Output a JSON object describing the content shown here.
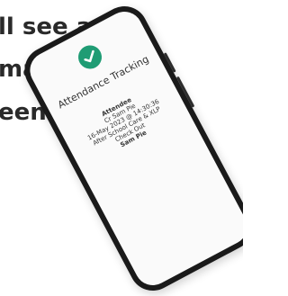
{
  "hero_text": {
    "line1": "ll see a",
    "line2": "mation",
    "line3": "een"
  },
  "screen": {
    "title": "Attendance Tracking",
    "check_color": "#1f9c74",
    "details": {
      "heading": "Attendee",
      "attendee_short": "Cr Sam Pie",
      "datetime": "16-May 2023 @ 14:30:36",
      "program": "After School Care & XLP",
      "action": "Check Out",
      "name": "Sam Pie"
    }
  }
}
